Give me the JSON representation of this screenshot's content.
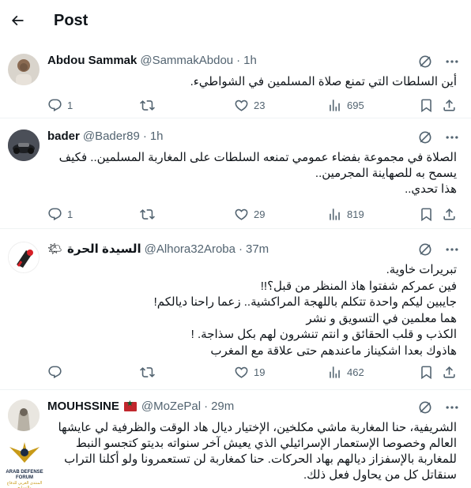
{
  "header": {
    "title": "Post",
    "back_icon": "arrow-left-icon"
  },
  "colors": {
    "text": "#0f1419",
    "secondary": "#536471",
    "divider": "#eff3f4",
    "flag_red": "#c1272d",
    "flag_green": "#006233"
  },
  "tweets": [
    {
      "name": "Abdou Sammak",
      "handle": "@SammakAbdou",
      "dot": "·",
      "time": "1h",
      "lines": [
        "أين السلطات التي تمنع صلاة المسلمين في الشواطيء."
      ],
      "stats": {
        "replies": "1",
        "retweets": "",
        "likes": "23",
        "views": "695"
      }
    },
    {
      "name": "bader",
      "handle": "@Bader89",
      "dot": "·",
      "time": "1h",
      "lines": [
        "الصلاة في مجموعة بفضاء عمومي تمنعه السلطات على المغاربة المسلمين.. فكيف",
        "يسمح به للصهاينة المجرمين..",
        "هذا تحدي.."
      ],
      "stats": {
        "replies": "1",
        "retweets": "",
        "likes": "29",
        "views": "819"
      }
    },
    {
      "name": "السيدة الحرة",
      "name_emoji": "🌤",
      "handle": "@Alhora32Aroba",
      "dot": "·",
      "time": "37m",
      "lines": [
        "تبريرات خاوية.",
        "فين عمركم شفتوا هاذ المنظر من قبل؟!!",
        "جايبين ليكم واحدة تتكلم باللهجة المراكشية.. زعما راحنا ديالكم!",
        "هما معلمين في التسويق و نشر",
        "الكذب و قلب الحقائق و انتم تنشرون لهم بكل سذاجة. !",
        "هاذوك بعدا اشكيناز ماعندهم حتى علاقة مع المغرب"
      ],
      "stats": {
        "replies": "",
        "retweets": "",
        "likes": "19",
        "views": "462"
      }
    },
    {
      "name": "MOUHSSINE",
      "handle": "@MoZePal",
      "dot": "·",
      "time": "29m",
      "flag": "moroccan-flag",
      "lines": [
        "الشريفية، حنا المغاربة ماشي مكلخين، الإختيار ديال هاد الوقت والظرفية لي عايشها",
        "العالم وخصوصا الإستعمار الإسرائيلي الذي يعيش آخر سنواته بديتو كتجسو النبط",
        "للمغاربة بالإسفزاز ديالهم بهاد الحركات. حنا كمغاربة لن تستعمرونا ولو أكلنا التراب",
        "سنقاتل كل من يحاول فعل ذلك."
      ]
    }
  ],
  "watermark": {
    "line1": "ARAB DEFENSE FORUM",
    "line2": "المنتدى العربي للدفاع والتسليح"
  }
}
